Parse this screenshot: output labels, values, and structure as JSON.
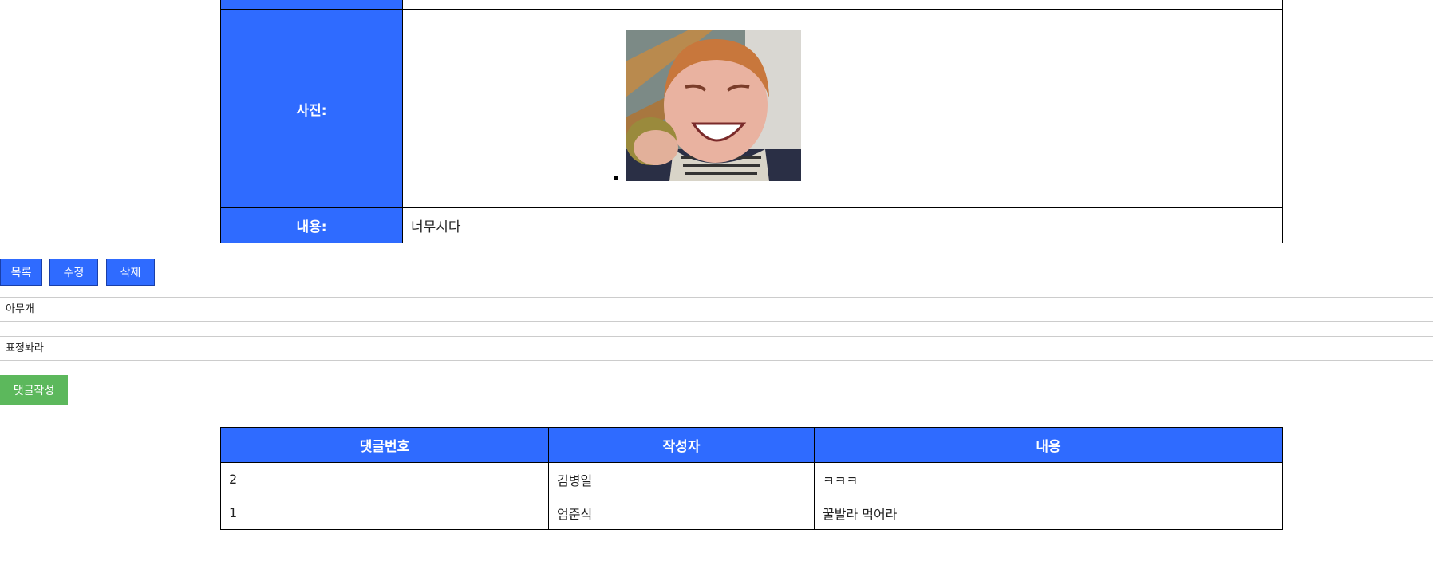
{
  "detail": {
    "photo_label": "사진:",
    "photo_alt": "웃는 아이 사진",
    "content_label": "내용:",
    "content_value": "너무시다"
  },
  "actions": {
    "list_label": "목록",
    "edit_label": "수정",
    "delete_label": "삭제"
  },
  "comment_form": {
    "writer_value": "아무개",
    "content_value": "표정봐라",
    "submit_label": "댓글작성"
  },
  "comments": {
    "headers": [
      "댓글번호",
      "작성자",
      "내용"
    ],
    "rows": [
      [
        "2",
        "김병일",
        "ㅋㅋㅋ"
      ],
      [
        "1",
        "엄준식",
        "꿀발라 먹어라"
      ]
    ]
  },
  "colors": {
    "header_blue": "#2f6bff",
    "comment_button_green": "#5cb85c"
  }
}
